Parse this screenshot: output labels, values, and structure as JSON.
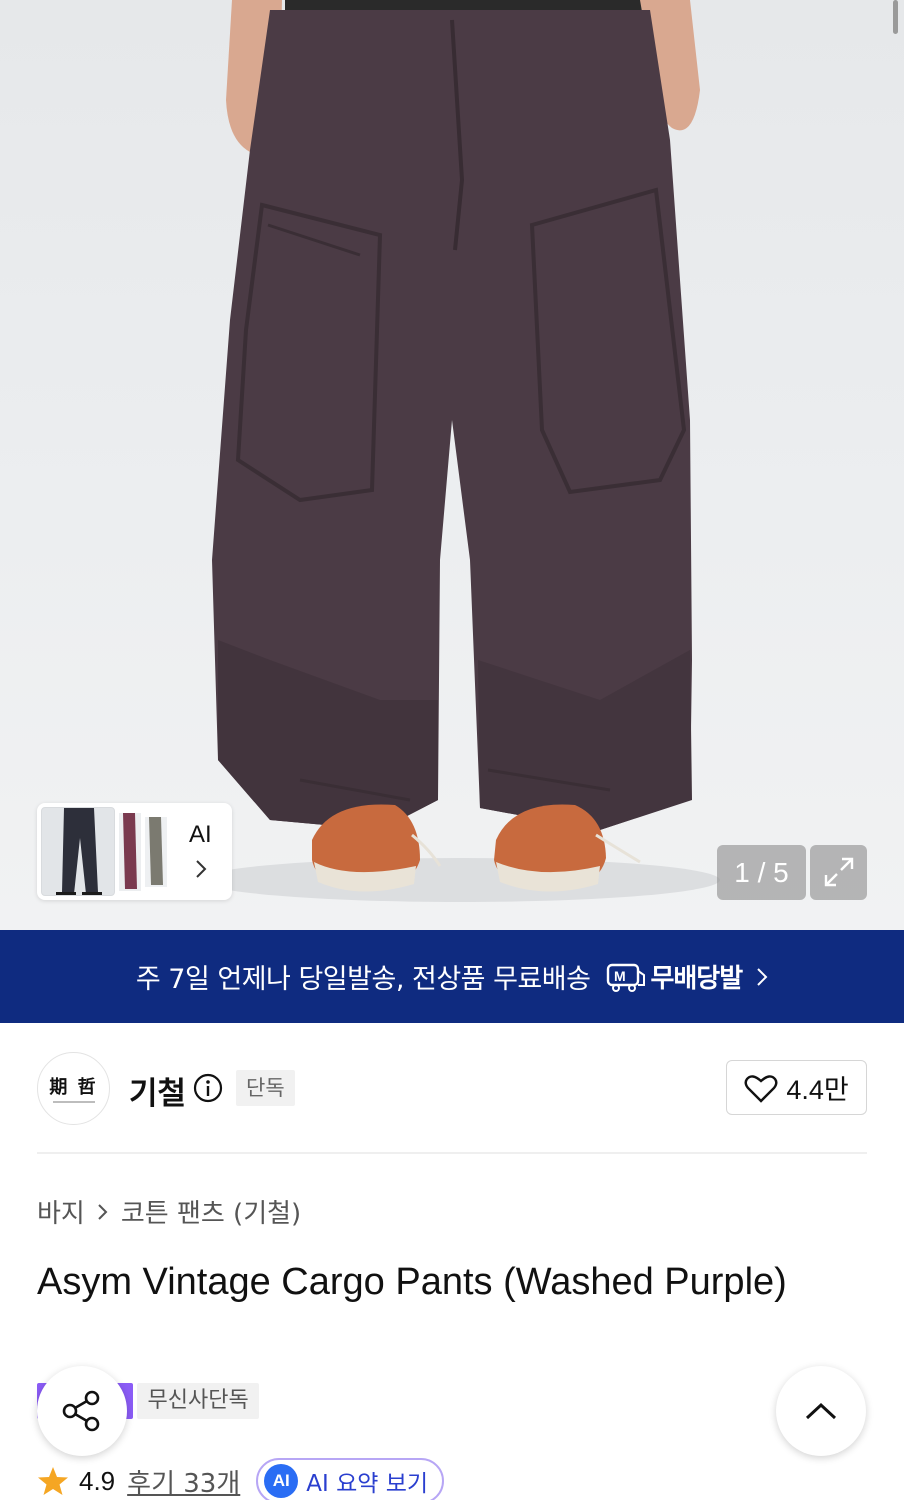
{
  "gallery": {
    "ai_label": "AI",
    "counter": "1 / 5"
  },
  "banner": {
    "text": "주 7일 언제나 당일발송, 전상품 무료배송",
    "service_name": "무배당발",
    "color": "#0f2b80"
  },
  "brand": {
    "logo_text": "期 哲",
    "name": "기철",
    "exclusive_label": "단독",
    "likes": "4.4만"
  },
  "breadcrumb": {
    "items": [
      "바지",
      "코튼 팬츠 (기철)"
    ]
  },
  "product": {
    "title": "Asym Vintage Cargo Pants (Washed Purple)",
    "badges": [
      "스타",
      "무신사단독"
    ]
  },
  "rating": {
    "score": "4.9",
    "reviews": "후기 33개",
    "ai_badge": "AI",
    "ai_summary": "AI 요약 보기"
  },
  "icons": {
    "share": "share-icon",
    "scroll_top": "chevron-up-icon",
    "expand": "expand-icon",
    "like": "heart-icon",
    "info": "info-icon",
    "star": "star-icon"
  }
}
